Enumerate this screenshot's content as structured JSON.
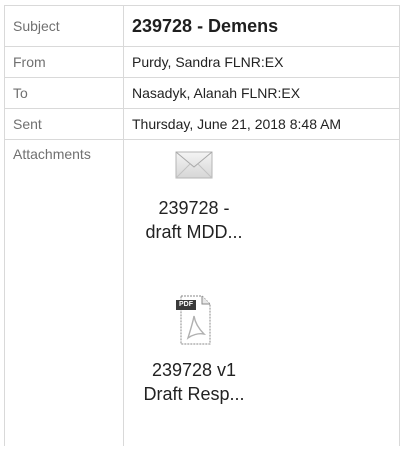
{
  "header": {
    "subject_label": "Subject",
    "subject_value": "239728 - Demens",
    "from_label": "From",
    "from_value": "Purdy, Sandra FLNR:EX",
    "to_label": "To",
    "to_value": "Nasadyk, Alanah FLNR:EX",
    "sent_label": "Sent",
    "sent_value": "Thursday, June 21, 2018 8:48 AM",
    "attachments_label": "Attachments"
  },
  "attachments": [
    {
      "icon": "envelope-icon",
      "line1": "239728 -",
      "line2": "draft MDD..."
    },
    {
      "icon": "pdf-file-icon",
      "badge": "PDF",
      "line1": "239728 v1",
      "line2": "Draft Resp..."
    }
  ]
}
